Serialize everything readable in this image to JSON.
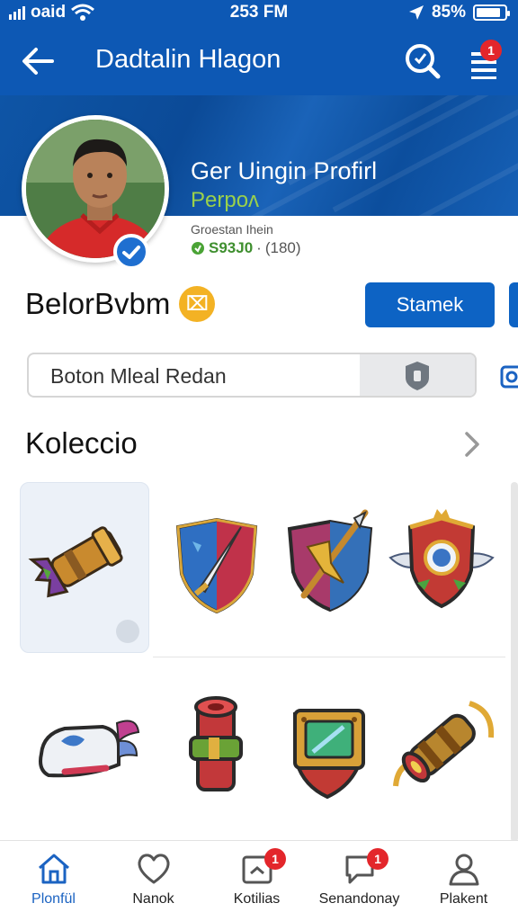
{
  "status_bar": {
    "carrier": "oaid",
    "time": "253 FM",
    "battery": "85%",
    "battery_level": 0.85
  },
  "app_bar": {
    "title": "Dadtalin Hlagon",
    "menu_badge": "1"
  },
  "profile": {
    "title": "Ger Uingin Profirl",
    "subtitle": "Perpoʌ",
    "meta": "Groestan Ihein",
    "stat_value": "S93J0",
    "stat_sep": "·",
    "stat_count": "(180)",
    "name": "BelorBvbm",
    "badge_glyph": "⌧"
  },
  "actions": {
    "follow_label": "Stamek"
  },
  "search": {
    "value": "Boton Mleal Redan"
  },
  "collection": {
    "title": "Koleccio",
    "items": [
      {
        "icon": "cannon-icon"
      },
      {
        "icon": "sword-shield-icon"
      },
      {
        "icon": "spear-shield-icon"
      },
      {
        "icon": "winged-shield-icon"
      },
      {
        "icon": "winged-boot-icon"
      },
      {
        "icon": "scroll-icon"
      },
      {
        "icon": "gem-shield-icon"
      },
      {
        "icon": "horn-cannon-icon"
      }
    ]
  },
  "nav": {
    "items": [
      {
        "label": "Plonfül",
        "icon": "home-icon",
        "active": true
      },
      {
        "label": "Nanok",
        "icon": "heart-icon"
      },
      {
        "label": "Kotilias",
        "icon": "badge-icon",
        "badge": "1"
      },
      {
        "label": "Senandonay",
        "icon": "chat-icon",
        "badge": "1"
      },
      {
        "label": "Plakent",
        "icon": "person-icon"
      }
    ]
  },
  "colors": {
    "primary": "#0d58b4",
    "accent_green": "#9ad14b",
    "badge_orange": "#f3b224",
    "alert": "#e3262b"
  }
}
